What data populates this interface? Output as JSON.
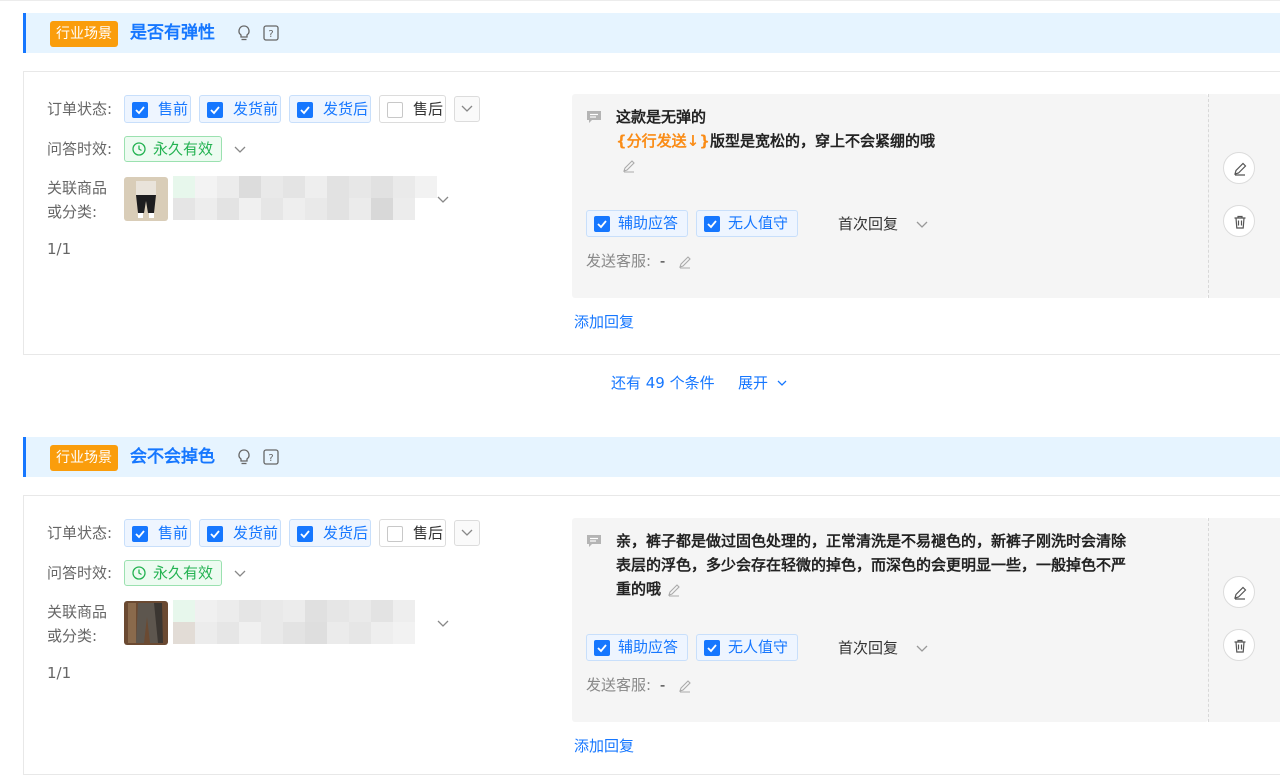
{
  "scenes": [
    {
      "tag": "行业场景",
      "title": "是否有弹性",
      "order_status_label": "订单状态:",
      "statuses": [
        {
          "label": "售前",
          "checked": true
        },
        {
          "label": "发货前",
          "checked": true
        },
        {
          "label": "发货后",
          "checked": true
        },
        {
          "label": "售后",
          "checked": false
        }
      ],
      "validity_label": "问答时效:",
      "validity_value": "永久有效",
      "product_label_1": "关联商品",
      "product_label_2": "或分类:",
      "page_count": "1/1",
      "reply_lines": [
        [
          {
            "text": "这款是无弹的",
            "var": false
          }
        ],
        [
          {
            "text": "{分行发送↓}",
            "var": true
          },
          {
            "text": "版型是宽松的，穿上不会紧绷的哦",
            "var": false
          }
        ]
      ],
      "assist_label": "辅助应答",
      "unattended_label": "无人值守",
      "first_reply_label": "首次回复",
      "send_agent_label": "发送客服:",
      "send_agent_value": "-",
      "add_reply_label": "添加回复"
    },
    {
      "tag": "行业场景",
      "title": "会不会掉色",
      "order_status_label": "订单状态:",
      "statuses": [
        {
          "label": "售前",
          "checked": true
        },
        {
          "label": "发货前",
          "checked": true
        },
        {
          "label": "发货后",
          "checked": true
        },
        {
          "label": "售后",
          "checked": false
        }
      ],
      "validity_label": "问答时效:",
      "validity_value": "永久有效",
      "product_label_1": "关联商品",
      "product_label_2": "或分类:",
      "page_count": "1/1",
      "reply_lines": [
        [
          {
            "text": "亲，裤子都是做过固色处理的，正常清洗是不易褪色的，新裤子刚洗时会清除",
            "var": false
          }
        ],
        [
          {
            "text": "表层的浮色，多少会存在轻微的掉色，而深色的会更明显一些，一般掉色不严",
            "var": false
          }
        ],
        [
          {
            "text": "重的哦",
            "var": false
          }
        ]
      ],
      "assist_label": "辅助应答",
      "unattended_label": "无人值守",
      "first_reply_label": "首次回复",
      "send_agent_label": "发送客服:",
      "send_agent_value": "-",
      "add_reply_label": "添加回复"
    }
  ],
  "more_conditions": {
    "text": "还有 49 个条件",
    "expand_label": "展开"
  },
  "colors": {
    "accent": "#1677ff",
    "tag_orange": "#fa9d0c",
    "valid_green": "#23b251",
    "variable_orange": "#fa8c16"
  }
}
